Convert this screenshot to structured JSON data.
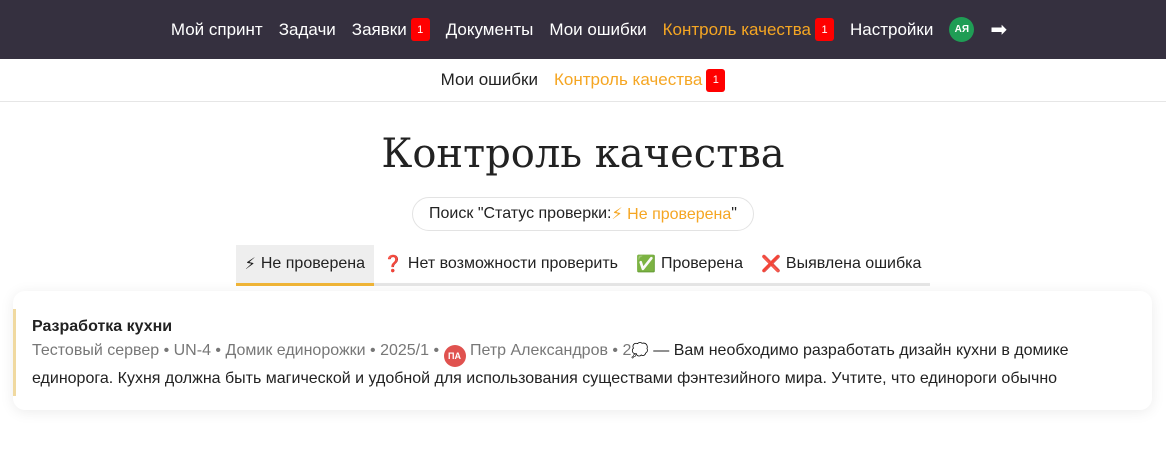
{
  "topnav": {
    "items": [
      {
        "label": "Мой спринт"
      },
      {
        "label": "Задачи"
      },
      {
        "label": "Заявки",
        "badge": "1"
      },
      {
        "label": "Документы"
      },
      {
        "label": "Мои ошибки"
      },
      {
        "label": "Контроль качества",
        "badge": "1",
        "active": true
      },
      {
        "label": "Настройки"
      }
    ],
    "avatar": "АЯ",
    "logout_icon": "➡"
  },
  "subnav": {
    "items": [
      {
        "label": "Мои ошибки"
      },
      {
        "label": "Контроль качества",
        "badge": "1",
        "active": true
      }
    ]
  },
  "page": {
    "title": "Контроль качества"
  },
  "search": {
    "prefix": "Поиск \"Статус проверки: ",
    "value": "⚡ Не проверена",
    "suffix": "\""
  },
  "tabs": [
    {
      "icon": "⚡",
      "label": "Не проверена",
      "active": true
    },
    {
      "icon": "❓",
      "label": "Нет возможности проверить"
    },
    {
      "icon": "✅",
      "label": "Проверена"
    },
    {
      "icon": "❌",
      "label": "Выявлена ошибка"
    }
  ],
  "card": {
    "title": "Разработка кухни",
    "server": "Тестовый сервер",
    "code": "UN-4",
    "project": "Домик единорожки",
    "sprint": "2025/1",
    "assignee_initials": "ПА",
    "assignee": "Петр Александров",
    "comments": "2",
    "comment_icon": "💭",
    "sep": " • ",
    "dash": " — ",
    "description": "Вам необходимо разработать дизайн кухни в домике единорога. Кухня должна быть магической и удобной для использования существами фэнтезийного мира. Учтите, что единороги обычно"
  },
  "colors": {
    "topbar_bg": "#35303f",
    "accent": "#f5a623",
    "badge": "#ff0000",
    "avatar_top": "#1f9d55",
    "avatar_card": "#e0524f"
  }
}
